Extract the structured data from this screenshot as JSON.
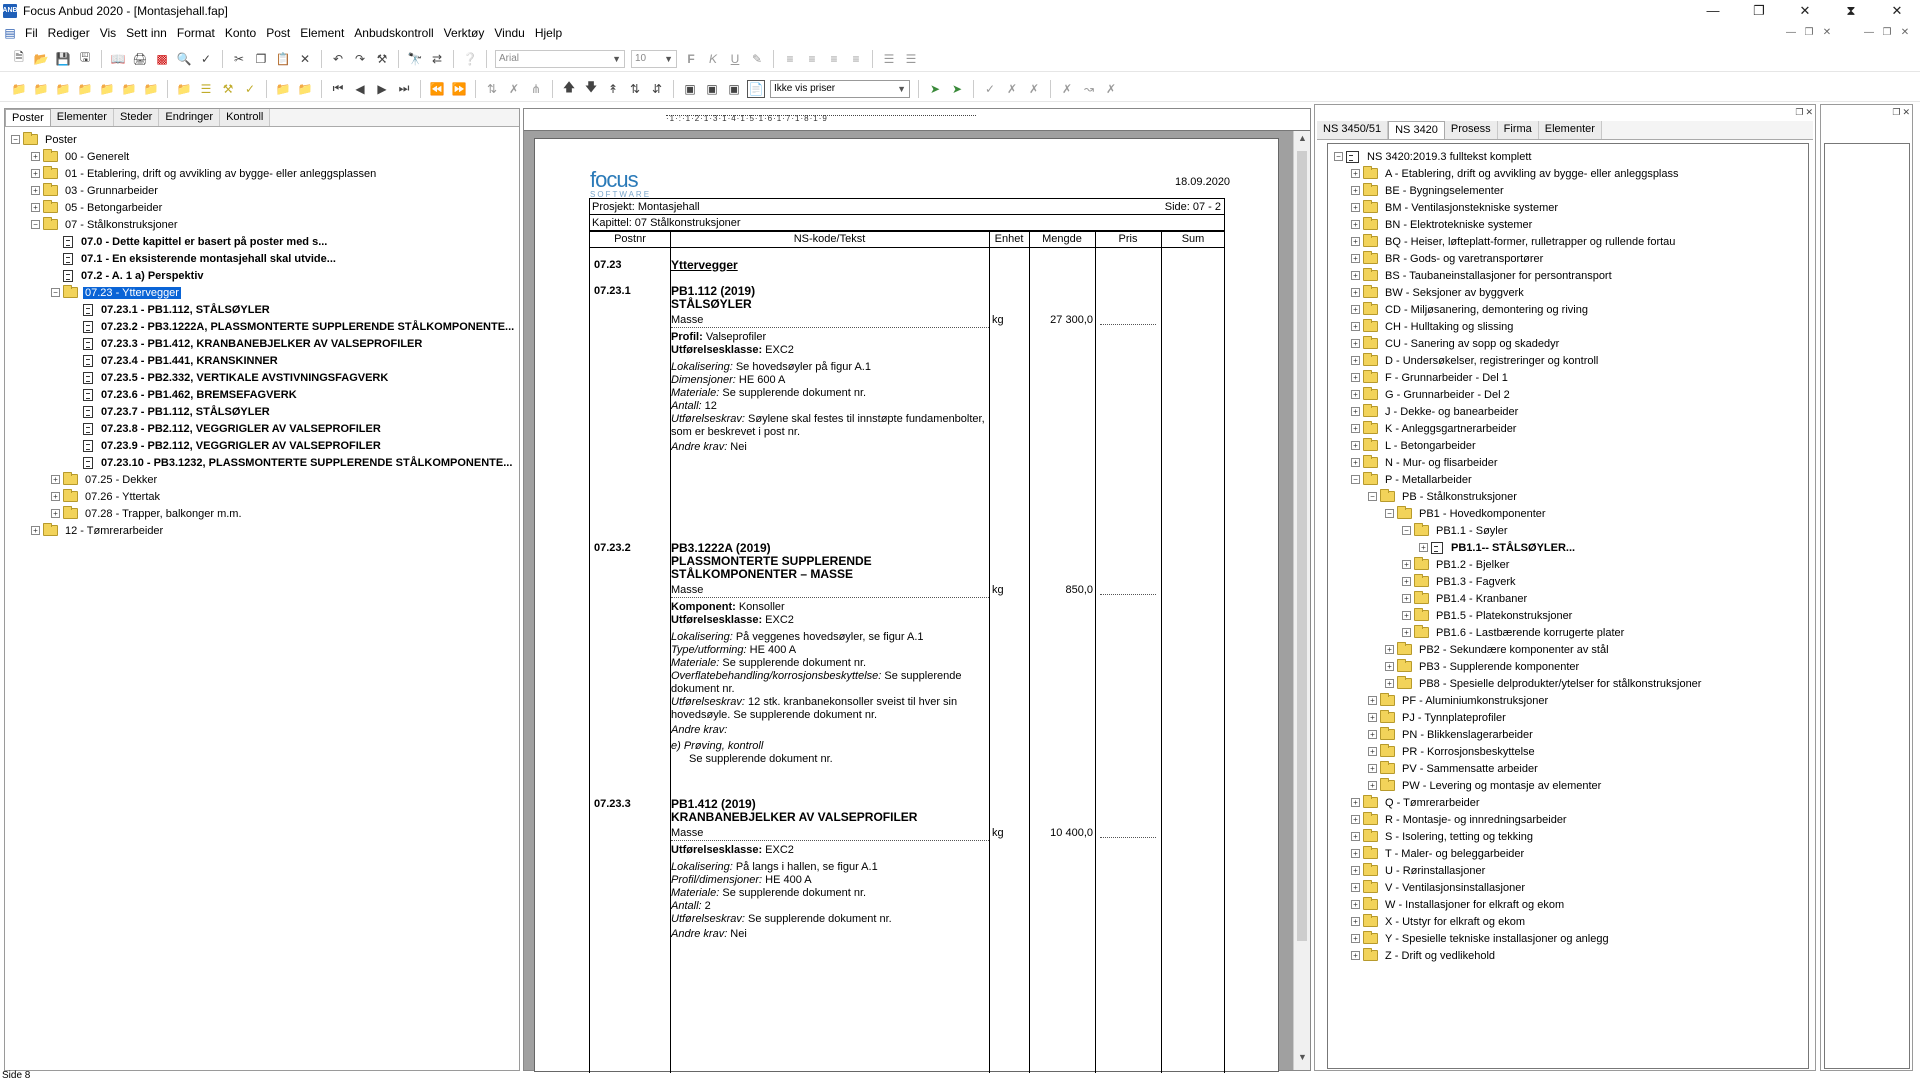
{
  "window": {
    "title": "Focus Anbud 2020 - [Montasjehall.fap]",
    "app_icon": "ANB"
  },
  "menu": [
    "Fil",
    "Rediger",
    "Vis",
    "Sett inn",
    "Format",
    "Konto",
    "Post",
    "Element",
    "Anbudskontroll",
    "Verktøy",
    "Vindu",
    "Hjelp"
  ],
  "toolbar": {
    "font_value": "Arial",
    "size_value": "10",
    "price_mode": "Ikke vis priser"
  },
  "left": {
    "tabs": [
      "Poster",
      "Elementer",
      "Steder",
      "Endringer",
      "Kontroll"
    ],
    "tree": [
      {
        "d": 0,
        "t": "folder",
        "e": "-",
        "l": "Poster"
      },
      {
        "d": 1,
        "t": "folder",
        "e": "+",
        "l": "00 - Generelt"
      },
      {
        "d": 1,
        "t": "folder",
        "e": "+",
        "l": "01 - Etablering, drift og avvikling av bygge- eller anleggsplassen"
      },
      {
        "d": 1,
        "t": "folder",
        "e": "+",
        "l": "03 - Grunnarbeider"
      },
      {
        "d": 1,
        "t": "folder",
        "e": "+",
        "l": "05 - Betongarbeider"
      },
      {
        "d": 1,
        "t": "folder",
        "e": "-",
        "l": "07 - Stålkonstruksjoner"
      },
      {
        "d": 2,
        "t": "doc",
        "l": "07.0 - Dette kapittel er basert på poster med s...",
        "b": true
      },
      {
        "d": 2,
        "t": "doc",
        "l": "07.1 - En eksisterende montasjehall skal utvide...",
        "b": true
      },
      {
        "d": 2,
        "t": "doc",
        "l": "07.2 - A. 1 a) Perspektiv",
        "b": true
      },
      {
        "d": 2,
        "t": "folder",
        "e": "-",
        "l": "07.23 - Yttervegger",
        "sel": true
      },
      {
        "d": 3,
        "t": "doc",
        "l": "07.23.1 - PB1.112, STÅLSØYLER",
        "b": true
      },
      {
        "d": 3,
        "t": "doc",
        "l": "07.23.2 - PB3.1222A, PLASSMONTERTE SUPPLERENDE STÅLKOMPONENTE...",
        "b": true
      },
      {
        "d": 3,
        "t": "doc",
        "l": "07.23.3 - PB1.412, KRANBANEBJELKER AV VALSEPROFILER",
        "b": true
      },
      {
        "d": 3,
        "t": "doc",
        "l": "07.23.4 - PB1.441, KRANSKINNER",
        "b": true
      },
      {
        "d": 3,
        "t": "doc",
        "l": "07.23.5 - PB2.332, VERTIKALE AVSTIVNINGSFAGVERK",
        "b": true
      },
      {
        "d": 3,
        "t": "doc",
        "l": "07.23.6 - PB1.462, BREMSEFAGVERK",
        "b": true
      },
      {
        "d": 3,
        "t": "doc",
        "l": "07.23.7 - PB1.112, STÅLSØYLER",
        "b": true
      },
      {
        "d": 3,
        "t": "doc",
        "l": "07.23.8 - PB2.112, VEGGRIGLER AV VALSEPROFILER",
        "b": true
      },
      {
        "d": 3,
        "t": "doc",
        "l": "07.23.9 - PB2.112, VEGGRIGLER AV VALSEPROFILER",
        "b": true
      },
      {
        "d": 3,
        "t": "doc",
        "l": "07.23.10 - PB3.1232, PLASSMONTERTE SUPPLERENDE STÅLKOMPONENTE...",
        "b": true
      },
      {
        "d": 2,
        "t": "folder",
        "e": "+",
        "l": "07.25 - Dekker"
      },
      {
        "d": 2,
        "t": "folder",
        "e": "+",
        "l": "07.26 - Yttertak"
      },
      {
        "d": 2,
        "t": "folder",
        "e": "+",
        "l": "07.28 - Trapper, balkonger m.m."
      },
      {
        "d": 1,
        "t": "folder",
        "e": "+",
        "l": "12 - Tømrerarbeider"
      }
    ]
  },
  "doc": {
    "logo": "focus",
    "logo_sub": "SOFTWARE",
    "date": "18.09.2020",
    "prosjekt": "Prosjekt:  Montasjehall",
    "side": "Side: 07 - 2",
    "kapittel": "Kapittel:  07 Stålkonstruksjoner",
    "cols": {
      "postnr": "Postnr",
      "nskode": "NS-kode/Tekst",
      "enhet": "Enhet",
      "mengde": "Mengde",
      "pris": "Pris",
      "sum": "Sum"
    },
    "section": {
      "pn": "07.23",
      "title": "Yttervegger"
    },
    "e1": {
      "pn": "07.23.1",
      "code": "PB1.112 (2019)",
      "name": "STÅLSØYLER",
      "masse": "Masse",
      "unit": "kg",
      "qty": "27 300,0",
      "l1b": "Profil:",
      "l1": " Valseprofiler",
      "l2b": "Utførelsesklasse:",
      "l2": " EXC2",
      "i1": "Lokalisering:",
      "v1": " Se hovedsøyler på figur A.1",
      "i2": "Dimensjoner:",
      "v2": " HE 600 A",
      "i3": "Materiale:",
      "v3": " Se supplerende dokument nr.",
      "i4": "Antall:",
      "v4": " 12",
      "i5": "Utførelseskrav:",
      "v5": " Søylene skal festes til innstøpte fundamenbolter, som er beskrevet i post nr.",
      "i6": "Andre krav:",
      "v6": " Nei"
    },
    "e2": {
      "pn": "07.23.2",
      "code": "PB3.1222A (2019)",
      "name": "PLASSMONTERTE SUPPLERENDE STÅLKOMPONENTER – MASSE",
      "masse": "Masse",
      "unit": "kg",
      "qty": "850,0",
      "l1b": "Komponent:",
      "l1": " Konsoller",
      "l2b": "Utførelsesklasse:",
      "l2": " EXC2",
      "i1": "Lokalisering:",
      "v1": " På veggenes hovedsøyler, se figur A.1",
      "i2": "Type/utforming:",
      "v2": " HE 400 A",
      "i3": "Materiale:",
      "v3": " Se supplerende dokument nr.",
      "i4": "Overflatebehandling/korrosjonsbeskyttelse:",
      "v4": " Se supplerende dokument nr.",
      "i5": "Utførelseskrav:",
      "v5": " 12 stk. kranbanekonsoller sveist til hver sin hovedsøyle. Se supplerende dokument nr.",
      "i6": "Andre krav:",
      "v6": "",
      "sub1": "e)  Prøving, kontroll",
      "sub2": "Se supplerende dokument nr."
    },
    "e3": {
      "pn": "07.23.3",
      "code": "PB1.412 (2019)",
      "name": "KRANBANEBJELKER AV VALSEPROFILER",
      "masse": "Masse",
      "unit": "kg",
      "qty": "10 400,0",
      "l2b": "Utførelsesklasse:",
      "l2": " EXC2",
      "i1": "Lokalisering:",
      "v1": " På langs i hallen, se figur A.1",
      "i2": "Profil/dimensjoner:",
      "v2": " HE 400 A",
      "i3": "Materiale:",
      "v3": " Se supplerende dokument nr.",
      "i4": "Antall:",
      "v4": " 2",
      "i5": "Utførelseskrav:",
      "v5": " Se supplerende dokument nr.",
      "i6": "Andre krav:",
      "v6": " Nei"
    }
  },
  "right": {
    "tabs": [
      "NS 3450/51",
      "NS 3420",
      "Prosess",
      "Firma",
      "Elementer"
    ],
    "tree": [
      {
        "d": 0,
        "t": "book",
        "e": "-",
        "l": "NS 3420:2019.3 fulltekst komplett"
      },
      {
        "d": 1,
        "t": "folder",
        "e": "+",
        "l": "A - Etablering, drift og avvikling av bygge- eller anleggsplass"
      },
      {
        "d": 1,
        "t": "folder",
        "e": "+",
        "l": "BE - Bygningselementer"
      },
      {
        "d": 1,
        "t": "folder",
        "e": "+",
        "l": "BM - Ventilasjonstekniske systemer"
      },
      {
        "d": 1,
        "t": "folder",
        "e": "+",
        "l": "BN - Elektrotekniske systemer"
      },
      {
        "d": 1,
        "t": "folder",
        "e": "+",
        "l": "BQ - Heiser, løfteplatt-former, rulletrapper og rullende fortau"
      },
      {
        "d": 1,
        "t": "folder",
        "e": "+",
        "l": "BR - Gods- og varetransportører"
      },
      {
        "d": 1,
        "t": "folder",
        "e": "+",
        "l": "BS - Taubaneinstallasjoner for persontransport"
      },
      {
        "d": 1,
        "t": "folder",
        "e": "+",
        "l": "BW - Seksjoner av byggverk"
      },
      {
        "d": 1,
        "t": "folder",
        "e": "+",
        "l": "CD - Miljøsanering, demontering og riving"
      },
      {
        "d": 1,
        "t": "folder",
        "e": "+",
        "l": "CH - Hulltaking og slissing"
      },
      {
        "d": 1,
        "t": "folder",
        "e": "+",
        "l": "CU - Sanering av sopp og skadedyr"
      },
      {
        "d": 1,
        "t": "folder",
        "e": "+",
        "l": "D - Undersøkelser, registreringer og kontroll"
      },
      {
        "d": 1,
        "t": "folder",
        "e": "+",
        "l": "F - Grunnarbeider - Del 1"
      },
      {
        "d": 1,
        "t": "folder",
        "e": "+",
        "l": "G - Grunnarbeider - Del 2"
      },
      {
        "d": 1,
        "t": "folder",
        "e": "+",
        "l": "J - Dekke- og banearbeider"
      },
      {
        "d": 1,
        "t": "folder",
        "e": "+",
        "l": "K - Anleggsgartnerarbeider"
      },
      {
        "d": 1,
        "t": "folder",
        "e": "+",
        "l": "L - Betongarbeider"
      },
      {
        "d": 1,
        "t": "folder",
        "e": "+",
        "l": "N - Mur- og flisarbeider"
      },
      {
        "d": 1,
        "t": "folder",
        "e": "-",
        "l": "P - Metallarbeider"
      },
      {
        "d": 2,
        "t": "folder",
        "e": "-",
        "l": "PB - Stålkonstruksjoner"
      },
      {
        "d": 3,
        "t": "folder",
        "e": "-",
        "l": "PB1 - Hovedkomponenter"
      },
      {
        "d": 4,
        "t": "folder",
        "e": "-",
        "l": "PB1.1 - Søyler"
      },
      {
        "d": 5,
        "t": "grid",
        "e": "+",
        "l": "PB1.1--  STÅLSØYLER...",
        "b": true
      },
      {
        "d": 4,
        "t": "folder",
        "e": "+",
        "l": "PB1.2 - Bjelker"
      },
      {
        "d": 4,
        "t": "folder",
        "e": "+",
        "l": "PB1.3 - Fagverk"
      },
      {
        "d": 4,
        "t": "folder",
        "e": "+",
        "l": "PB1.4 - Kranbaner"
      },
      {
        "d": 4,
        "t": "folder",
        "e": "+",
        "l": "PB1.5 - Platekonstruksjoner"
      },
      {
        "d": 4,
        "t": "folder",
        "e": "+",
        "l": "PB1.6 - Lastbærende korrugerte plater"
      },
      {
        "d": 3,
        "t": "folder",
        "e": "+",
        "l": "PB2 - Sekundære komponenter av stål"
      },
      {
        "d": 3,
        "t": "folder",
        "e": "+",
        "l": "PB3 - Supplerende komponenter"
      },
      {
        "d": 3,
        "t": "folder",
        "e": "+",
        "l": "PB8 - Spesielle delprodukter/ytelser for stålkonstruksjoner"
      },
      {
        "d": 2,
        "t": "folder",
        "e": "+",
        "l": "PF - Aluminiumkonstruksjoner"
      },
      {
        "d": 2,
        "t": "folder",
        "e": "+",
        "l": "PJ - Tynnplateprofiler"
      },
      {
        "d": 2,
        "t": "folder",
        "e": "+",
        "l": "PN - Blikkenslagerarbeider"
      },
      {
        "d": 2,
        "t": "folder",
        "e": "+",
        "l": "PR - Korrosjonsbeskyttelse"
      },
      {
        "d": 2,
        "t": "folder",
        "e": "+",
        "l": "PV - Sammensatte arbeider"
      },
      {
        "d": 2,
        "t": "folder",
        "e": "+",
        "l": "PW - Levering og montasje av elementer"
      },
      {
        "d": 1,
        "t": "folder",
        "e": "+",
        "l": "Q - Tømrerarbeider"
      },
      {
        "d": 1,
        "t": "folder",
        "e": "+",
        "l": "R - Montasje- og innredningsarbeider"
      },
      {
        "d": 1,
        "t": "folder",
        "e": "+",
        "l": "S - Isolering, tetting og tekking"
      },
      {
        "d": 1,
        "t": "folder",
        "e": "+",
        "l": "T - Maler- og beleggarbeider"
      },
      {
        "d": 1,
        "t": "folder",
        "e": "+",
        "l": "U - Rørinstallasjoner"
      },
      {
        "d": 1,
        "t": "folder",
        "e": "+",
        "l": "V - Ventilasjonsinstallasjoner"
      },
      {
        "d": 1,
        "t": "folder",
        "e": "+",
        "l": "W - Installasjoner for elkraft og ekom"
      },
      {
        "d": 1,
        "t": "folder",
        "e": "+",
        "l": "X - Utstyr for elkraft og ekom"
      },
      {
        "d": 1,
        "t": "folder",
        "e": "+",
        "l": "Y - Spesielle tekniske installasjoner og anlegg"
      },
      {
        "d": 1,
        "t": "folder",
        "e": "+",
        "l": "Z - Drift og vedlikehold"
      }
    ]
  },
  "status": {
    "page": "Side 8"
  }
}
